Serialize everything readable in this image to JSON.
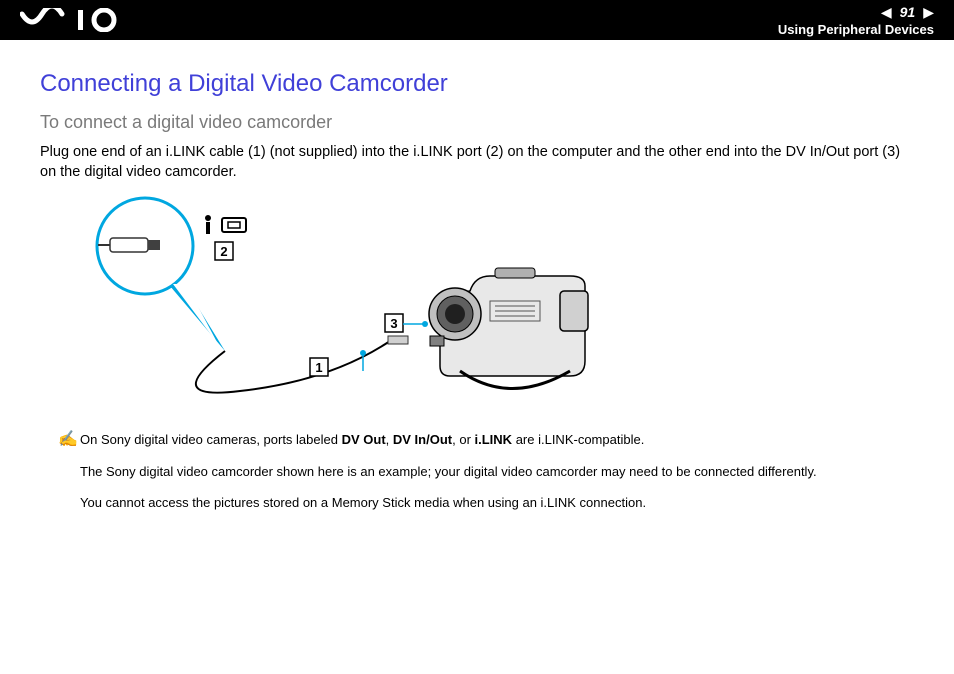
{
  "header": {
    "page_number": "91",
    "section": "Using Peripheral Devices"
  },
  "title": "Connecting a Digital Video Camcorder",
  "subtitle": "To connect a digital video camcorder",
  "body": "Plug one end of an i.LINK cable (1) (not supplied) into the i.LINK port (2) on the computer and the other end into the DV In/Out port (3) on the digital video camcorder.",
  "diagram": {
    "callouts": [
      "1",
      "2",
      "3"
    ]
  },
  "notes": {
    "line1_pre": "On Sony digital video cameras, ports labeled ",
    "b1": "DV Out",
    "sep1": ", ",
    "b2": "DV In/Out",
    "sep2": ", or ",
    "b3": "i.LINK",
    "line1_post": " are i.LINK-compatible.",
    "line2": "The Sony digital video camcorder shown here is an example; your digital video camcorder may need to be connected differently.",
    "line3": "You cannot access the pictures stored on a Memory Stick media when using an i.LINK connection."
  }
}
